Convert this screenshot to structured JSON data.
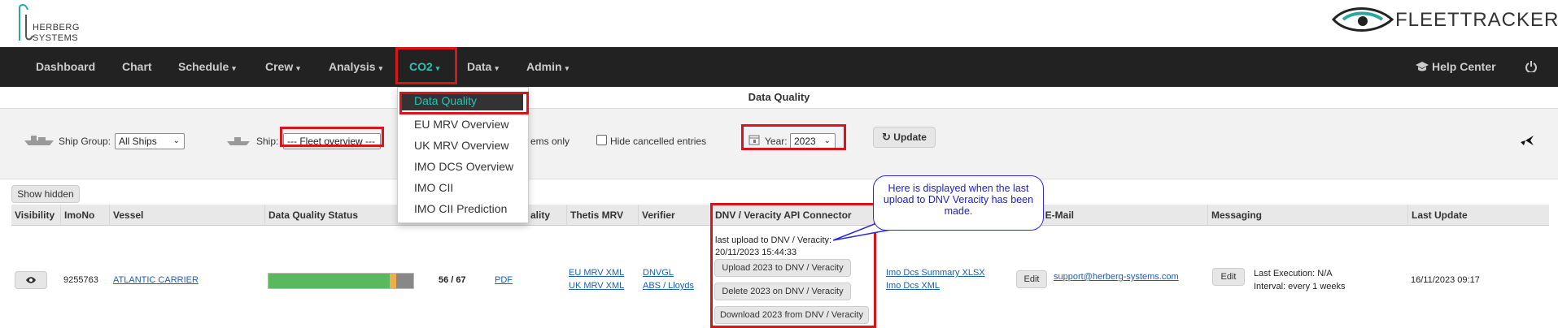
{
  "brand": {
    "left_logo_line1": "HERBERG",
    "left_logo_line2": "SYSTEMS",
    "right_logo_text": "FLEETTRACKER"
  },
  "nav": {
    "items": [
      {
        "label": "Dashboard",
        "caret": false
      },
      {
        "label": "Chart",
        "caret": false
      },
      {
        "label": "Schedule",
        "caret": true
      },
      {
        "label": "Crew",
        "caret": true
      },
      {
        "label": "Analysis",
        "caret": true
      },
      {
        "label": "CO2",
        "caret": true,
        "active": true
      },
      {
        "label": "Data",
        "caret": true
      },
      {
        "label": "Admin",
        "caret": true
      }
    ],
    "help_center": "Help Center",
    "caret_glyph": "▾"
  },
  "co2_menu": {
    "items": [
      "Data Quality",
      "EU MRV Overview",
      "UK MRV Overview",
      "IMO DCS Overview",
      "IMO CII",
      "IMO CII Prediction"
    ],
    "active_index": 0
  },
  "page": {
    "title": "Data Quality"
  },
  "filters": {
    "ship_group_label": "Ship Group:",
    "ship_group_value": "All Ships",
    "ship_label": "Ship:",
    "ship_value": "--- Fleet overview ---",
    "problems_only_partial": "ems only",
    "hide_cancelled_label": "Hide cancelled entries",
    "year_label": "Year:",
    "year_value": "2023",
    "update_button": "Update"
  },
  "table": {
    "show_hidden_button": "Show hidden",
    "headers": [
      "Visibility",
      "ImoNo",
      "Vessel",
      "Data Quality Status",
      "ality",
      "Thetis MRV",
      "Verifier",
      "DNV / Veracity API Connector",
      "l E-Mail",
      "Messaging",
      "Last Update"
    ],
    "rows": [
      {
        "imo": "9255763",
        "vessel": "ATLANTIC CARRIER",
        "quality_score": "56 / 67",
        "quality_fraction": 0.836,
        "warning_fraction": 0.045,
        "report_link": "PDF",
        "thetis_links": [
          "EU MRV XML",
          "UK MRV XML"
        ],
        "verifier_links": [
          "DNVGL",
          "ABS / Lloyds"
        ],
        "dnv_status_line1": "last upload to DNV / Veracity:",
        "dnv_status_line2": "20/11/2023 15:44:33",
        "dnv_buttons": [
          "Upload 2023 to DNV / Veracity",
          "Delete 2023 on DNV / Veracity",
          "Download 2023 from DNV / Veracity"
        ],
        "imo_dcs_links": [
          "Imo Dcs Summary XLSX",
          "Imo Dcs XML"
        ],
        "email_edit": "Edit",
        "email": "support@herberg-systems.com",
        "messaging_edit": "Edit",
        "last_execution": "Last Execution: N/A",
        "interval": "Interval: every 1 weeks",
        "last_update": "16/11/2023 09:17"
      }
    ]
  },
  "callout": {
    "text": "Here is displayed when the last upload to DNV Veracity has been made."
  },
  "colors": {
    "nav_bg": "#222222",
    "accent": "#2ec1b5",
    "highlight_border": "#d9141b",
    "progress_good": "#5cb85c",
    "progress_warn": "#f0ad4e",
    "progress_missing": "#888888",
    "callout_text": "#2020cc"
  }
}
